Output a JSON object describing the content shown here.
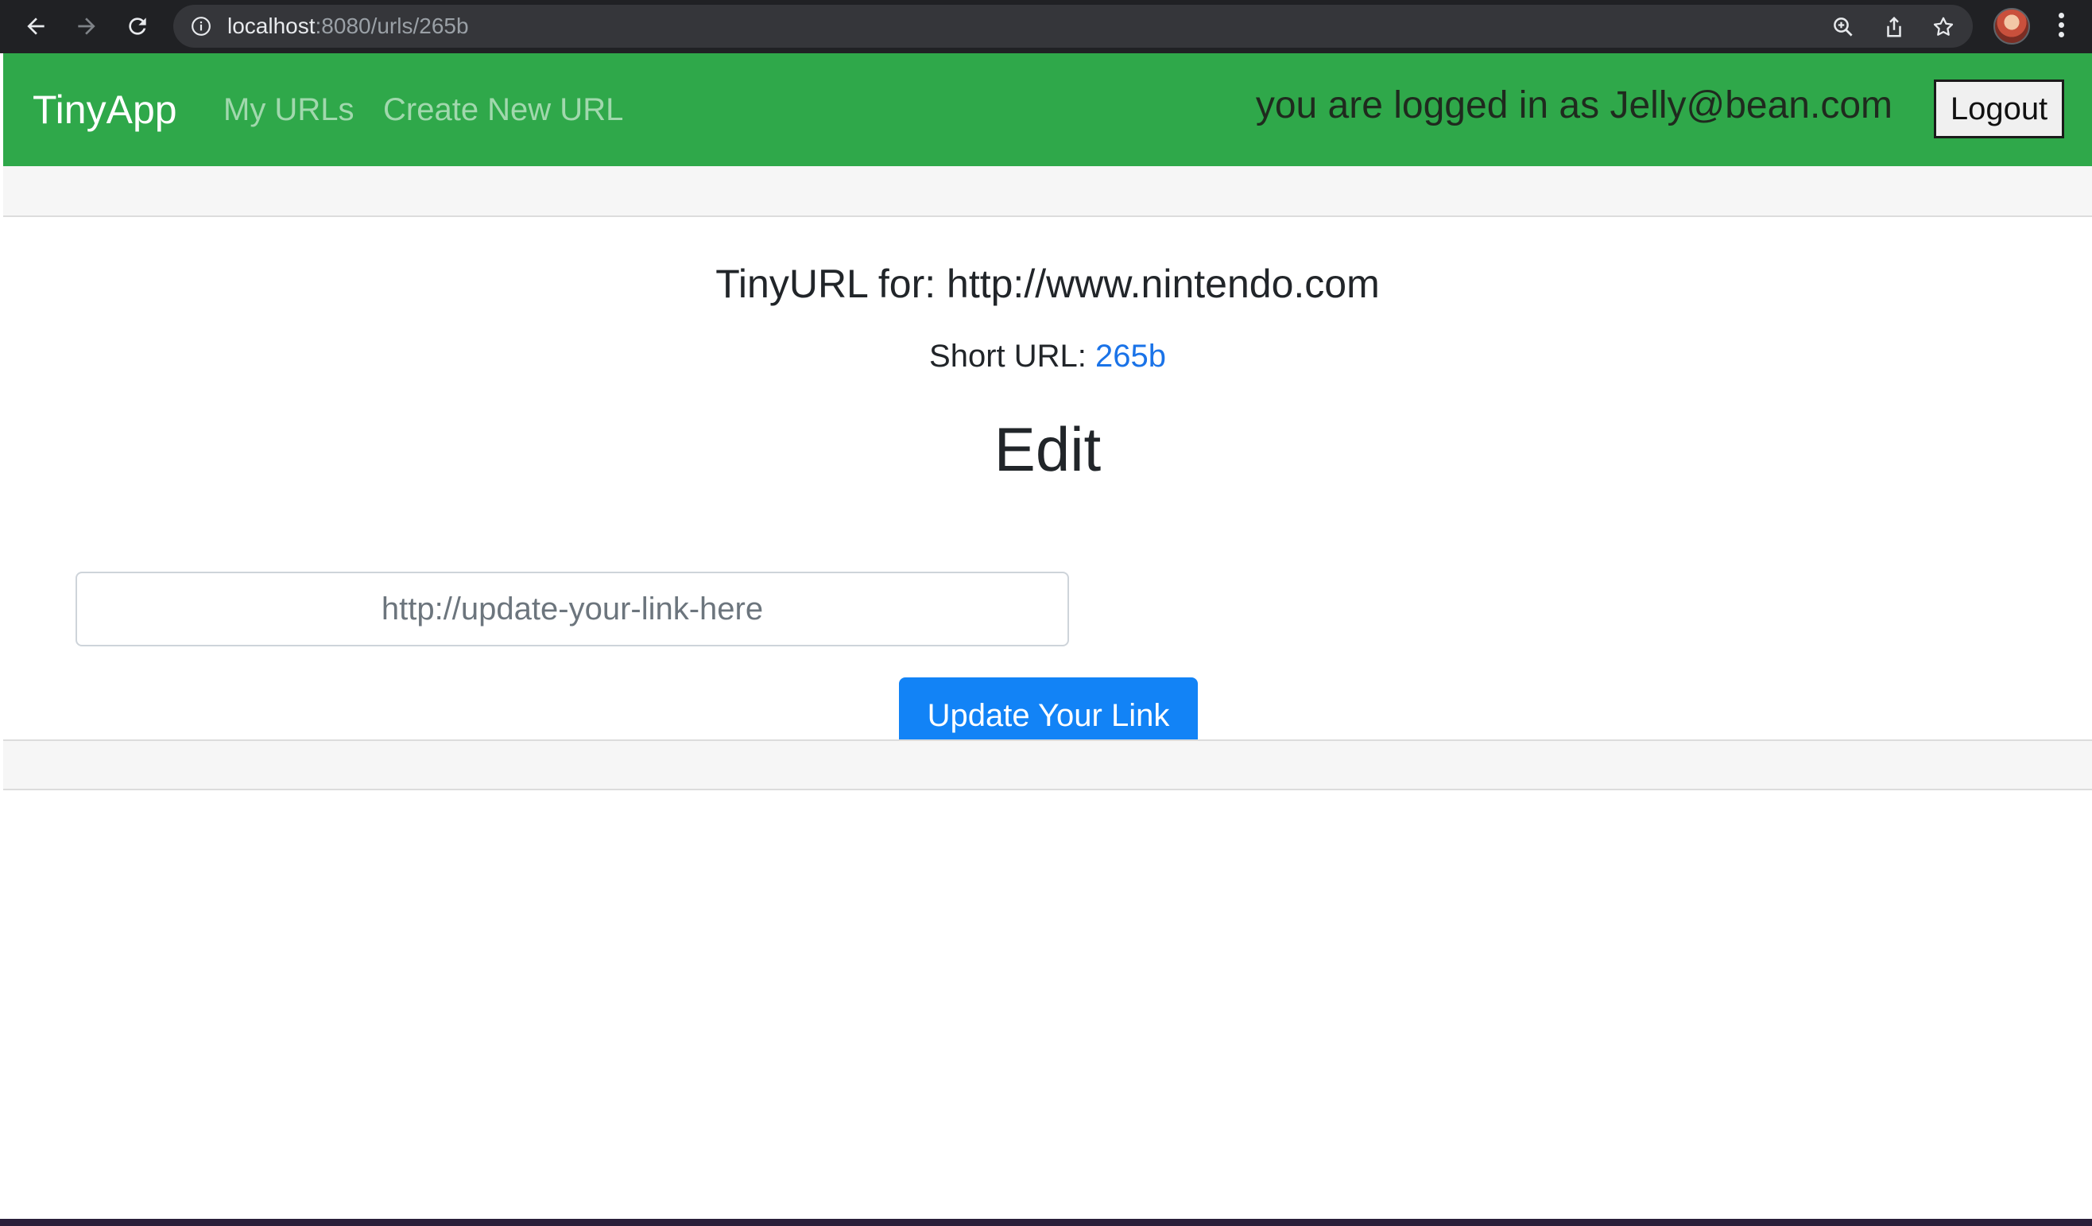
{
  "browser": {
    "url_host": "localhost",
    "url_rest": ":8080/urls/265b",
    "icons": [
      "back-icon",
      "forward-icon",
      "reload-icon",
      "site-info-icon",
      "zoom-icon",
      "share-icon",
      "bookmark-star-icon",
      "profile-avatar",
      "menu-kebab-icon"
    ]
  },
  "navbar": {
    "brand": "TinyApp",
    "links": [
      "My URLs",
      "Create New URL"
    ],
    "logged_in_text": "you are logged in as Jelly@bean.com",
    "logout_label": "Logout",
    "color": "#2fa84a"
  },
  "main": {
    "title": "TinyURL for: http://www.nintendo.com",
    "short_url_label": "Short URL: ",
    "short_url_value": "265b",
    "edit_heading": "Edit",
    "input_placeholder": "http://update-your-link-here",
    "update_button": "Update Your Link",
    "button_color": "#1283f6",
    "link_color": "#1a73e8"
  }
}
